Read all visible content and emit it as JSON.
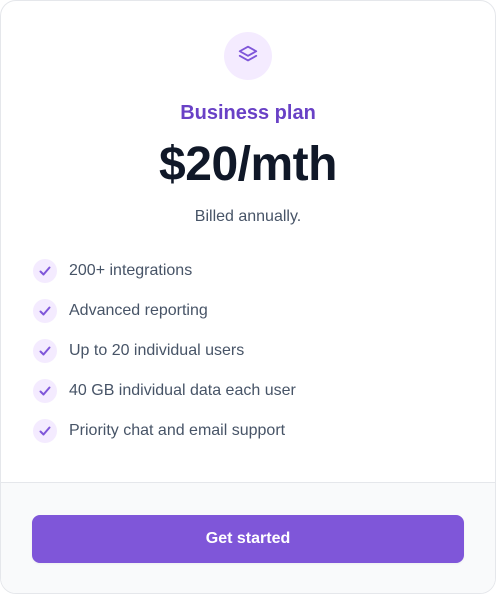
{
  "plan": {
    "icon": "layers-icon",
    "name": "Business plan",
    "price": "$20/mth",
    "billing": "Billed annually."
  },
  "features": [
    {
      "icon": "check-icon",
      "label": "200+ integrations"
    },
    {
      "icon": "check-icon",
      "label": "Advanced reporting"
    },
    {
      "icon": "check-icon",
      "label": "Up to 20 individual users"
    },
    {
      "icon": "check-icon",
      "label": "40 GB individual data each user"
    },
    {
      "icon": "check-icon",
      "label": "Priority chat and email support"
    }
  ],
  "cta": {
    "label": "Get started"
  },
  "colors": {
    "accent": "#7f56d9",
    "accent_text": "#6941c6",
    "accent_light": "#f4ebff",
    "heading": "#101828",
    "body": "#475467",
    "footer_bg": "#f9fafb",
    "border": "#e5e7eb"
  }
}
